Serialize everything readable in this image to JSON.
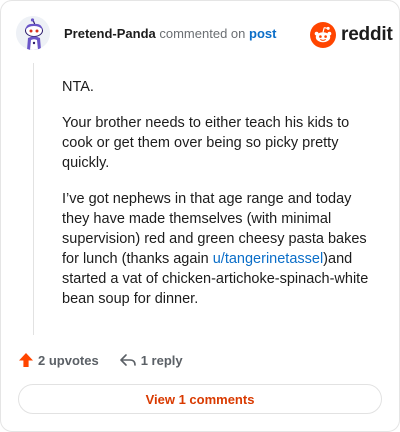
{
  "header": {
    "username": "Pretend-Panda",
    "action_text": "commented on",
    "post_link": "post",
    "brand": "reddit"
  },
  "comment": {
    "p1": "NTA.",
    "p2": "Your brother needs to either teach his kids to cook or get them over being so picky pretty quickly.",
    "p3_before": "I’ve got nephews in that age range and today they have made themselves (with minimal supervision) red and green cheesy pasta bakes for lunch (thanks again ",
    "p3_link": "u/tangerinetassel",
    "p3_after": ")and started a vat of chicken-artichoke-spinach-white bean soup for dinner."
  },
  "actions": {
    "upvotes": "2 upvotes",
    "reply": "1 reply"
  },
  "view_comments": "View 1 comments",
  "colors": {
    "brand": "#ff4500",
    "link": "#0b6ec8",
    "view_button_text": "#d93a00"
  },
  "icons": [
    "avatar-icon",
    "reddit-logo-icon",
    "upvote-arrow-icon",
    "reply-icon"
  ]
}
